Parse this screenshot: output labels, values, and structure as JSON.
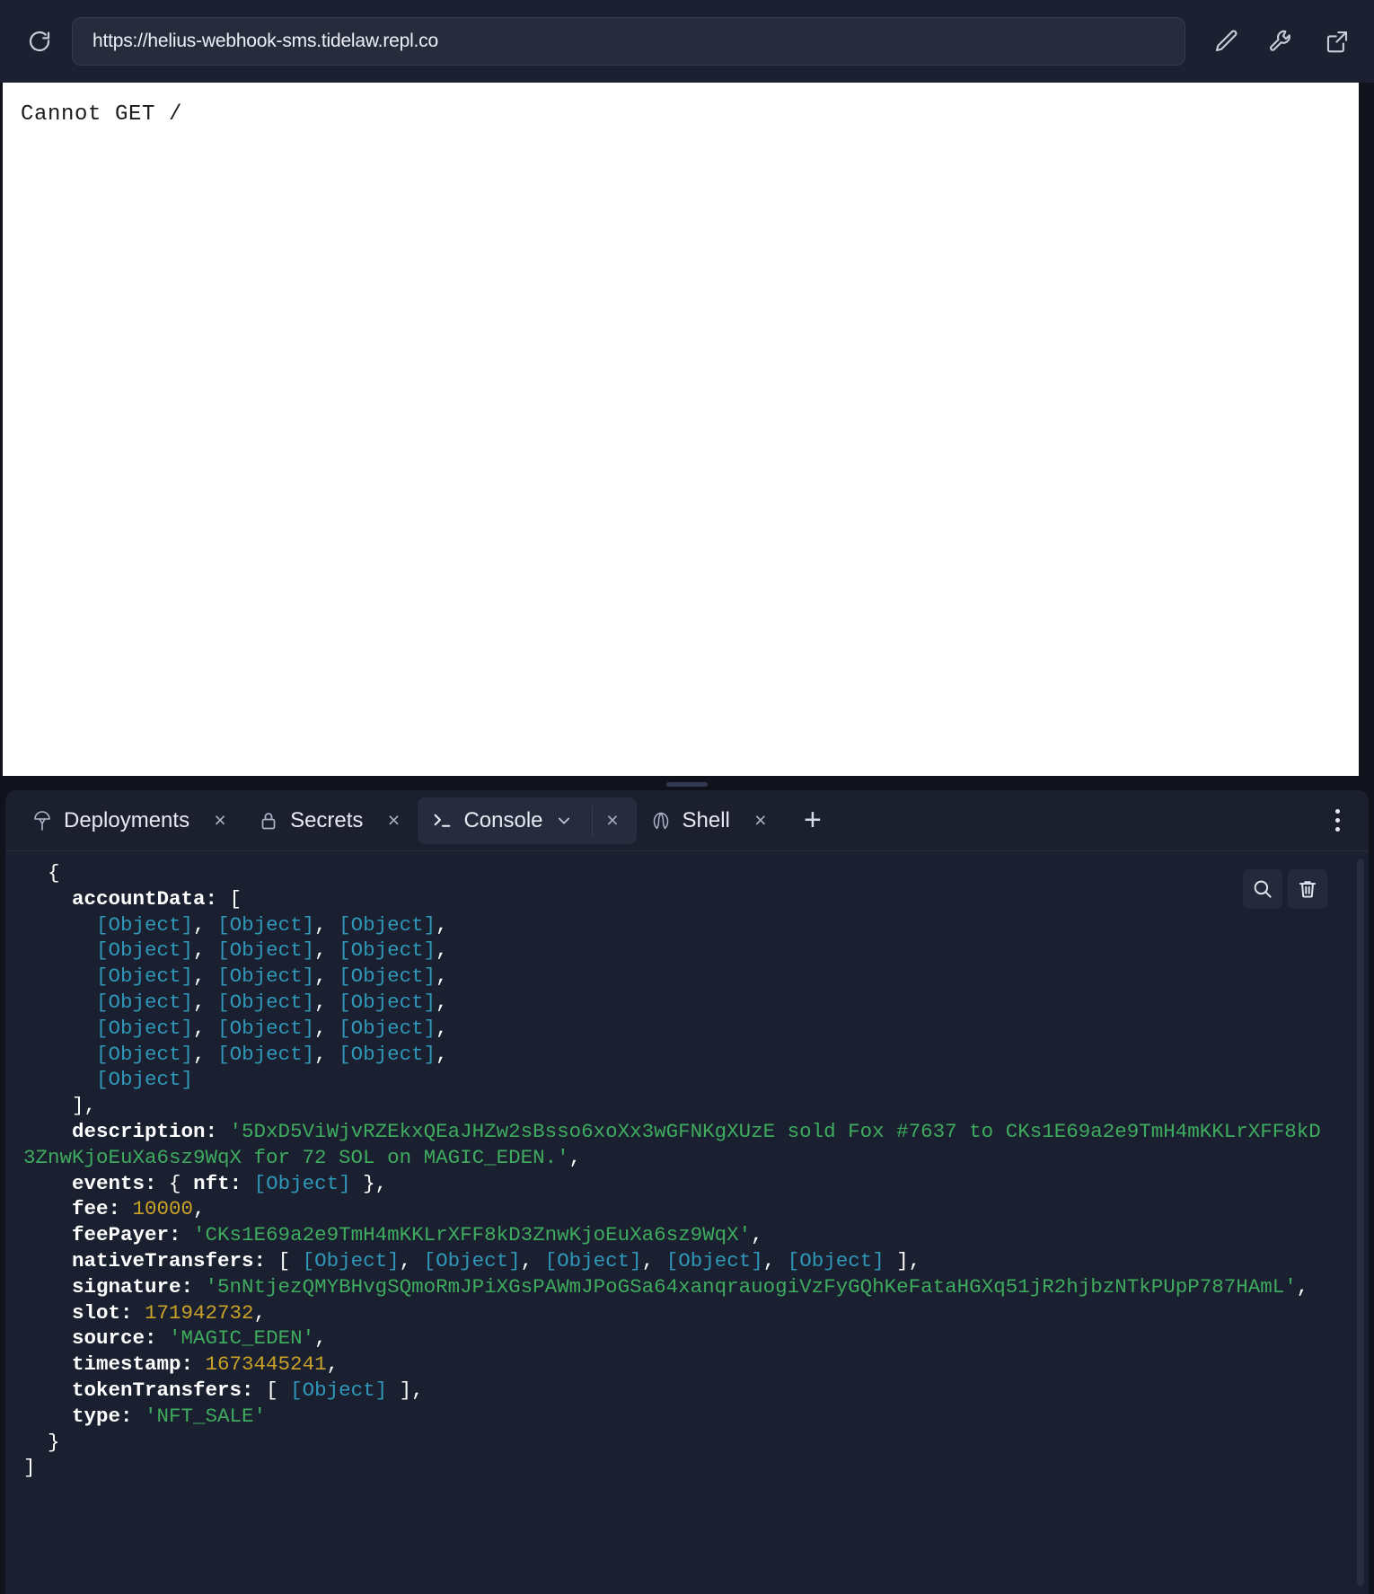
{
  "browser": {
    "url": "https://helius-webhook-sms.tidelaw.repl.co",
    "reload_icon": "reload-icon",
    "icons": [
      {
        "name": "pencil-icon",
        "label": "Edit"
      },
      {
        "name": "wrench-icon",
        "label": "Tools"
      },
      {
        "name": "external-link-icon",
        "label": "Open in new tab"
      }
    ]
  },
  "preview": {
    "body_text": "Cannot GET /"
  },
  "panel": {
    "tabs": [
      {
        "id": "deployments",
        "label": "Deployments",
        "icon": "rocket-icon",
        "active": false,
        "closable": true,
        "chevron": false
      },
      {
        "id": "secrets",
        "label": "Secrets",
        "icon": "lock-icon",
        "active": false,
        "closable": true,
        "chevron": false
      },
      {
        "id": "console",
        "label": "Console",
        "icon": "prompt-icon",
        "active": true,
        "closable": true,
        "chevron": true
      },
      {
        "id": "shell",
        "label": "Shell",
        "icon": "shell-icon",
        "active": false,
        "closable": true,
        "chevron": false
      }
    ],
    "add_tab_label": "+",
    "close_label": "×",
    "kebab_name": "panel-options-icon",
    "console_actions": [
      {
        "name": "search-icon",
        "label": "Search"
      },
      {
        "name": "trash-icon",
        "label": "Clear console"
      }
    ]
  },
  "console": {
    "object_token": "[Object]",
    "lines": [
      {
        "indent": 1,
        "segments": [
          {
            "t": "{",
            "c": "pn"
          }
        ]
      },
      {
        "indent": 2,
        "segments": [
          {
            "t": "accountData: ",
            "c": "k"
          },
          {
            "t": "[",
            "c": "pn"
          }
        ]
      },
      {
        "indent": 3,
        "segments": [
          {
            "t": "[Object]",
            "c": "ob"
          },
          {
            "t": ", ",
            "c": "pn"
          },
          {
            "t": "[Object]",
            "c": "ob"
          },
          {
            "t": ", ",
            "c": "pn"
          },
          {
            "t": "[Object]",
            "c": "ob"
          },
          {
            "t": ",",
            "c": "pn"
          }
        ]
      },
      {
        "indent": 3,
        "segments": [
          {
            "t": "[Object]",
            "c": "ob"
          },
          {
            "t": ", ",
            "c": "pn"
          },
          {
            "t": "[Object]",
            "c": "ob"
          },
          {
            "t": ", ",
            "c": "pn"
          },
          {
            "t": "[Object]",
            "c": "ob"
          },
          {
            "t": ",",
            "c": "pn"
          }
        ]
      },
      {
        "indent": 3,
        "segments": [
          {
            "t": "[Object]",
            "c": "ob"
          },
          {
            "t": ", ",
            "c": "pn"
          },
          {
            "t": "[Object]",
            "c": "ob"
          },
          {
            "t": ", ",
            "c": "pn"
          },
          {
            "t": "[Object]",
            "c": "ob"
          },
          {
            "t": ",",
            "c": "pn"
          }
        ]
      },
      {
        "indent": 3,
        "segments": [
          {
            "t": "[Object]",
            "c": "ob"
          },
          {
            "t": ", ",
            "c": "pn"
          },
          {
            "t": "[Object]",
            "c": "ob"
          },
          {
            "t": ", ",
            "c": "pn"
          },
          {
            "t": "[Object]",
            "c": "ob"
          },
          {
            "t": ",",
            "c": "pn"
          }
        ]
      },
      {
        "indent": 3,
        "segments": [
          {
            "t": "[Object]",
            "c": "ob"
          },
          {
            "t": ", ",
            "c": "pn"
          },
          {
            "t": "[Object]",
            "c": "ob"
          },
          {
            "t": ", ",
            "c": "pn"
          },
          {
            "t": "[Object]",
            "c": "ob"
          },
          {
            "t": ",",
            "c": "pn"
          }
        ]
      },
      {
        "indent": 3,
        "segments": [
          {
            "t": "[Object]",
            "c": "ob"
          },
          {
            "t": ", ",
            "c": "pn"
          },
          {
            "t": "[Object]",
            "c": "ob"
          },
          {
            "t": ", ",
            "c": "pn"
          },
          {
            "t": "[Object]",
            "c": "ob"
          },
          {
            "t": ",",
            "c": "pn"
          }
        ]
      },
      {
        "indent": 3,
        "segments": [
          {
            "t": "[Object]",
            "c": "ob"
          }
        ]
      },
      {
        "indent": 2,
        "segments": [
          {
            "t": "],",
            "c": "pn"
          }
        ]
      },
      {
        "indent": 2,
        "segments": [
          {
            "t": "description: ",
            "c": "k"
          },
          {
            "t": "'5DxD5ViWjvRZEkxQEaJHZw2sBsso6xoXx3wGFNKgXUzE sold Fox #7637 to CKs1E69a2e9TmH4mKKLrXFF8kD3ZnwKjoEuXa6sz9WqX for 72 SOL on MAGIC_EDEN.'",
            "c": "st"
          },
          {
            "t": ",",
            "c": "pn"
          }
        ]
      },
      {
        "indent": 2,
        "segments": [
          {
            "t": "events: ",
            "c": "k"
          },
          {
            "t": "{ ",
            "c": "pn"
          },
          {
            "t": "nft: ",
            "c": "k"
          },
          {
            "t": "[Object]",
            "c": "ob"
          },
          {
            "t": " },",
            "c": "pn"
          }
        ]
      },
      {
        "indent": 2,
        "segments": [
          {
            "t": "fee: ",
            "c": "k"
          },
          {
            "t": "10000",
            "c": "nu"
          },
          {
            "t": ",",
            "c": "pn"
          }
        ]
      },
      {
        "indent": 2,
        "segments": [
          {
            "t": "feePayer: ",
            "c": "k"
          },
          {
            "t": "'CKs1E69a2e9TmH4mKKLrXFF8kD3ZnwKjoEuXa6sz9WqX'",
            "c": "st"
          },
          {
            "t": ",",
            "c": "pn"
          }
        ]
      },
      {
        "indent": 2,
        "segments": [
          {
            "t": "nativeTransfers: ",
            "c": "k"
          },
          {
            "t": "[ ",
            "c": "pn"
          },
          {
            "t": "[Object]",
            "c": "ob"
          },
          {
            "t": ", ",
            "c": "pn"
          },
          {
            "t": "[Object]",
            "c": "ob"
          },
          {
            "t": ", ",
            "c": "pn"
          },
          {
            "t": "[Object]",
            "c": "ob"
          },
          {
            "t": ", ",
            "c": "pn"
          },
          {
            "t": "[Object]",
            "c": "ob"
          },
          {
            "t": ", ",
            "c": "pn"
          },
          {
            "t": "[Object]",
            "c": "ob"
          },
          {
            "t": " ],",
            "c": "pn"
          }
        ]
      },
      {
        "indent": 2,
        "segments": [
          {
            "t": "signature: ",
            "c": "k"
          },
          {
            "t": "'5nNtjezQMYBHvgSQmoRmJPiXGsPAWmJPoGSa64xanqrauogiVzFyGQhKeFataHGXq51jR2hjbzNTkPUpP787HAmL'",
            "c": "st"
          },
          {
            "t": ",",
            "c": "pn"
          }
        ]
      },
      {
        "indent": 2,
        "segments": [
          {
            "t": "slot: ",
            "c": "k"
          },
          {
            "t": "171942732",
            "c": "nu"
          },
          {
            "t": ",",
            "c": "pn"
          }
        ]
      },
      {
        "indent": 2,
        "segments": [
          {
            "t": "source: ",
            "c": "k"
          },
          {
            "t": "'MAGIC_EDEN'",
            "c": "st"
          },
          {
            "t": ",",
            "c": "pn"
          }
        ]
      },
      {
        "indent": 2,
        "segments": [
          {
            "t": "timestamp: ",
            "c": "k"
          },
          {
            "t": "1673445241",
            "c": "nu"
          },
          {
            "t": ",",
            "c": "pn"
          }
        ]
      },
      {
        "indent": 2,
        "segments": [
          {
            "t": "tokenTransfers: ",
            "c": "k"
          },
          {
            "t": "[ ",
            "c": "pn"
          },
          {
            "t": "[Object]",
            "c": "ob"
          },
          {
            "t": " ],",
            "c": "pn"
          }
        ]
      },
      {
        "indent": 2,
        "segments": [
          {
            "t": "type: ",
            "c": "k"
          },
          {
            "t": "'NFT_SALE'",
            "c": "st"
          }
        ]
      },
      {
        "indent": 1,
        "segments": [
          {
            "t": "}",
            "c": "pn"
          }
        ]
      },
      {
        "indent": 0,
        "segments": [
          {
            "t": "]",
            "c": "pn"
          }
        ]
      }
    ]
  },
  "colors": {
    "panel_bg": "#1b1f2e",
    "console_bg": "#1b2030",
    "browser_bg": "#1c2030",
    "string_green": "#3eab5e",
    "object_teal": "#2f97b8",
    "number_gold": "#c9a227"
  }
}
